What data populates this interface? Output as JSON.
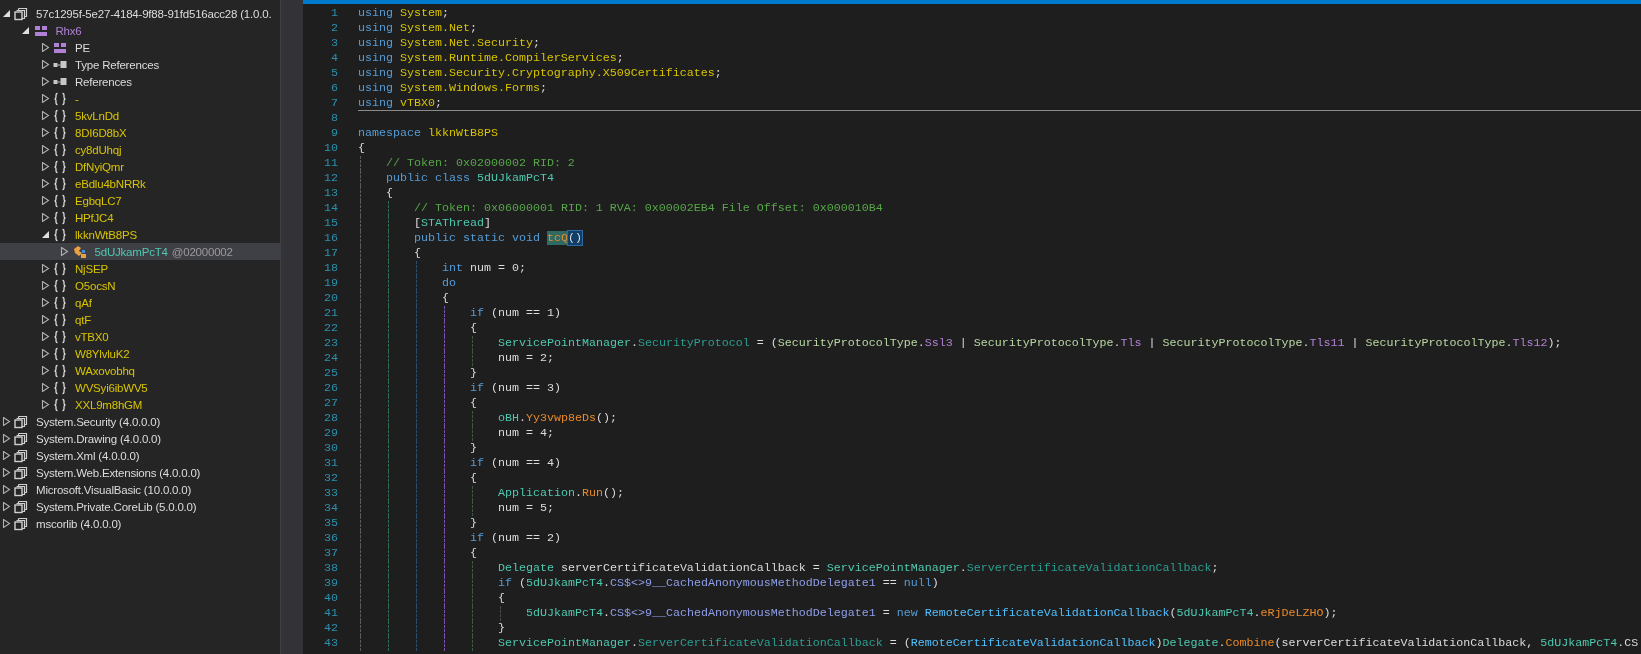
{
  "tree": [
    {
      "label": "57c1295f-5e27-4184-9f88-91fd516acc28 (1.0.0.",
      "kind": "assembly",
      "expanded": true,
      "selected": false,
      "children": [
        {
          "label": "Rhx6",
          "kind": "module",
          "expanded": true,
          "selected": false,
          "children": [
            {
              "label": "PE",
              "kind": "pe",
              "expanded": false,
              "selected": false
            },
            {
              "label": "Type References",
              "kind": "refs",
              "expanded": false,
              "selected": false
            },
            {
              "label": "References",
              "kind": "refs",
              "expanded": false,
              "selected": false
            },
            {
              "label": "-",
              "kind": "namespace",
              "expanded": false,
              "selected": false
            },
            {
              "label": "5kvLnDd",
              "kind": "namespace",
              "expanded": false,
              "selected": false
            },
            {
              "label": "8DI6D8bX",
              "kind": "namespace",
              "expanded": false,
              "selected": false
            },
            {
              "label": "cy8dUhqj",
              "kind": "namespace",
              "expanded": false,
              "selected": false
            },
            {
              "label": "DfNyiQmr",
              "kind": "namespace",
              "expanded": false,
              "selected": false
            },
            {
              "label": "eBdlu4bNRRk",
              "kind": "namespace",
              "expanded": false,
              "selected": false
            },
            {
              "label": "EgbqLC7",
              "kind": "namespace",
              "expanded": false,
              "selected": false
            },
            {
              "label": "HPfJC4",
              "kind": "namespace",
              "expanded": false,
              "selected": false
            },
            {
              "label": "lkknWtB8PS",
              "kind": "namespace",
              "expanded": true,
              "selected": false,
              "children": [
                {
                  "label": "5dUJkamPcT4",
                  "token": "@02000002",
                  "kind": "class",
                  "expanded": false,
                  "selected": true
                }
              ]
            },
            {
              "label": "NjSEP",
              "kind": "namespace",
              "expanded": false,
              "selected": false
            },
            {
              "label": "O5ocsN",
              "kind": "namespace",
              "expanded": false,
              "selected": false
            },
            {
              "label": "qAf",
              "kind": "namespace",
              "expanded": false,
              "selected": false
            },
            {
              "label": "qtF",
              "kind": "namespace",
              "expanded": false,
              "selected": false
            },
            {
              "label": "vTBX0",
              "kind": "namespace",
              "expanded": false,
              "selected": false
            },
            {
              "label": "W8YlvluK2",
              "kind": "namespace",
              "expanded": false,
              "selected": false
            },
            {
              "label": "WAxovobhq",
              "kind": "namespace",
              "expanded": false,
              "selected": false
            },
            {
              "label": "WVSyi6ibWV5",
              "kind": "namespace",
              "expanded": false,
              "selected": false
            },
            {
              "label": "XXL9m8hGM",
              "kind": "namespace",
              "expanded": false,
              "selected": false
            }
          ]
        }
      ]
    },
    {
      "label": "System.Security (4.0.0.0)",
      "kind": "assembly",
      "expanded": false,
      "selected": false
    },
    {
      "label": "System.Drawing (4.0.0.0)",
      "kind": "assembly",
      "expanded": false,
      "selected": false
    },
    {
      "label": "System.Xml (4.0.0.0)",
      "kind": "assembly",
      "expanded": false,
      "selected": false
    },
    {
      "label": "System.Web.Extensions (4.0.0.0)",
      "kind": "assembly",
      "expanded": false,
      "selected": false
    },
    {
      "label": "Microsoft.VisualBasic (10.0.0.0)",
      "kind": "assembly",
      "expanded": false,
      "selected": false
    },
    {
      "label": "System.Private.CoreLib (5.0.0.0)",
      "kind": "assembly",
      "expanded": false,
      "selected": false
    },
    {
      "label": "mscorlib (4.0.0.0)",
      "kind": "assembly",
      "expanded": false,
      "selected": false
    }
  ],
  "editor": {
    "lines": [
      {
        "number": "1",
        "tokens": [
          {
            "text": "using",
            "kind": "keyword"
          },
          {
            "text": " System",
            "kind": "namespace"
          },
          {
            "text": ";",
            "kind": "plain"
          }
        ]
      },
      {
        "number": "2",
        "tokens": [
          {
            "text": "using",
            "kind": "keyword"
          },
          {
            "text": " System.Net",
            "kind": "namespace"
          },
          {
            "text": ";",
            "kind": "plain"
          }
        ]
      },
      {
        "number": "3",
        "tokens": [
          {
            "text": "using",
            "kind": "keyword"
          },
          {
            "text": " System.Net.Security",
            "kind": "namespace"
          },
          {
            "text": ";",
            "kind": "plain"
          }
        ]
      },
      {
        "number": "4",
        "tokens": [
          {
            "text": "using",
            "kind": "keyword"
          },
          {
            "text": " System.Runtime.CompilerServices",
            "kind": "namespace"
          },
          {
            "text": ";",
            "kind": "plain"
          }
        ]
      },
      {
        "number": "5",
        "tokens": [
          {
            "text": "using",
            "kind": "keyword"
          },
          {
            "text": " System.Security.Cryptography.X509Certificates",
            "kind": "namespace"
          },
          {
            "text": ";",
            "kind": "plain"
          }
        ]
      },
      {
        "number": "6",
        "tokens": [
          {
            "text": "using",
            "kind": "keyword"
          },
          {
            "text": " System.Windows.Forms",
            "kind": "namespace"
          },
          {
            "text": ";",
            "kind": "plain"
          }
        ]
      },
      {
        "number": "7",
        "separator": true,
        "tokens": [
          {
            "text": "using",
            "kind": "keyword"
          },
          {
            "text": " vTBX0",
            "kind": "namespace"
          },
          {
            "text": ";",
            "kind": "plain"
          }
        ]
      },
      {
        "number": "8"
      },
      {
        "number": "9",
        "tokens": [
          {
            "text": "namespace",
            "kind": "keyword"
          },
          {
            "text": " lkknWtB8PS",
            "kind": "namespace"
          }
        ]
      },
      {
        "number": "10",
        "tokens": [
          {
            "text": "{",
            "kind": "open"
          }
        ]
      },
      {
        "number": "11",
        "tokens": [
          {
            "text": "// Token: 0x02000002 RID: 2",
            "kind": "comment"
          }
        ]
      },
      {
        "number": "12",
        "tokens": [
          {
            "text": "public class",
            "kind": "keyword"
          },
          {
            "text": " 5dUJkamPcT4",
            "kind": "type"
          }
        ]
      },
      {
        "number": "13",
        "tokens": [
          {
            "text": "{",
            "kind": "open"
          }
        ]
      },
      {
        "number": "14",
        "tokens": [
          {
            "text": "// Token: 0x06000001 RID: 1 RVA: 0x00002EB4 File Offset: 0x000010B4",
            "kind": "comment"
          }
        ]
      },
      {
        "number": "15",
        "tokens": [
          {
            "text": "[",
            "kind": "plain"
          },
          {
            "text": "STAThread",
            "kind": "type"
          },
          {
            "text": "]",
            "kind": "plain"
          }
        ]
      },
      {
        "number": "16",
        "tokens": [
          {
            "text": "public static void ",
            "kind": "keyword"
          },
          {
            "text": "tcQ",
            "kind": "selection"
          },
          {
            "text": "()",
            "kind": "brace_match"
          }
        ]
      },
      {
        "number": "17",
        "tokens": [
          {
            "text": "{",
            "kind": "open"
          }
        ]
      },
      {
        "number": "18",
        "tokens": [
          {
            "text": "int",
            "kind": "keyword"
          },
          {
            "text": " num = 0;",
            "kind": "plain"
          }
        ]
      },
      {
        "number": "19",
        "tokens": [
          {
            "text": "do",
            "kind": "keyword"
          }
        ]
      },
      {
        "number": "20",
        "tokens": [
          {
            "text": "{",
            "kind": "open"
          }
        ]
      },
      {
        "number": "21",
        "tokens": [
          {
            "text": "if",
            "kind": "keyword"
          },
          {
            "text": " (num == 1)",
            "kind": "plain"
          }
        ]
      },
      {
        "number": "22",
        "tokens": [
          {
            "text": "{",
            "kind": "open"
          }
        ]
      },
      {
        "number": "23",
        "tokens": [
          {
            "text": "ServicePointManager",
            "kind": "type"
          },
          {
            "text": ".",
            "kind": "plain"
          },
          {
            "text": "SecurityProtocol",
            "kind": "property"
          },
          {
            "text": " = (",
            "kind": "plain"
          },
          {
            "text": "SecurityProtocolType",
            "kind": "enum_type"
          },
          {
            "text": ".",
            "kind": "plain"
          },
          {
            "text": "Ssl3",
            "kind": "enum_value"
          },
          {
            "text": " | ",
            "kind": "plain"
          },
          {
            "text": "SecurityProtocolType",
            "kind": "enum_type"
          },
          {
            "text": ".",
            "kind": "plain"
          },
          {
            "text": "Tls",
            "kind": "enum_value"
          },
          {
            "text": " | ",
            "kind": "plain"
          },
          {
            "text": "SecurityProtocolType",
            "kind": "enum_type"
          },
          {
            "text": ".",
            "kind": "plain"
          },
          {
            "text": "Tls11",
            "kind": "enum_value"
          },
          {
            "text": " | ",
            "kind": "plain"
          },
          {
            "text": "SecurityProtocolType",
            "kind": "enum_type"
          },
          {
            "text": ".",
            "kind": "plain"
          },
          {
            "text": "Tls12",
            "kind": "enum_value"
          },
          {
            "text": ");",
            "kind": "plain"
          }
        ]
      },
      {
        "number": "24",
        "tokens": [
          {
            "text": "num = 2;",
            "kind": "plain"
          }
        ]
      },
      {
        "number": "25",
        "tokens": [
          {
            "text": "}",
            "kind": "close"
          }
        ]
      },
      {
        "number": "26",
        "tokens": [
          {
            "text": "if",
            "kind": "keyword"
          },
          {
            "text": " (num == 3)",
            "kind": "plain"
          }
        ]
      },
      {
        "number": "27",
        "tokens": [
          {
            "text": "{",
            "kind": "open"
          }
        ]
      },
      {
        "number": "28",
        "tokens": [
          {
            "text": "oBH",
            "kind": "type"
          },
          {
            "text": ".",
            "kind": "plain"
          },
          {
            "text": "Yy3vwp8eDs",
            "kind": "method"
          },
          {
            "text": "();",
            "kind": "plain"
          }
        ]
      },
      {
        "number": "29",
        "tokens": [
          {
            "text": "num = 4;",
            "kind": "plain"
          }
        ]
      },
      {
        "number": "30",
        "tokens": [
          {
            "text": "}",
            "kind": "close"
          }
        ]
      },
      {
        "number": "31",
        "tokens": [
          {
            "text": "if",
            "kind": "keyword"
          },
          {
            "text": " (num == 4)",
            "kind": "plain"
          }
        ]
      },
      {
        "number": "32",
        "tokens": [
          {
            "text": "{",
            "kind": "open"
          }
        ]
      },
      {
        "number": "33",
        "tokens": [
          {
            "text": "Application",
            "kind": "type"
          },
          {
            "text": ".",
            "kind": "plain"
          },
          {
            "text": "Run",
            "kind": "method"
          },
          {
            "text": "();",
            "kind": "plain"
          }
        ]
      },
      {
        "number": "34",
        "tokens": [
          {
            "text": "num = 5;",
            "kind": "plain"
          }
        ]
      },
      {
        "number": "35",
        "tokens": [
          {
            "text": "}",
            "kind": "close"
          }
        ]
      },
      {
        "number": "36",
        "tokens": [
          {
            "text": "if",
            "kind": "keyword"
          },
          {
            "text": " (num == 2)",
            "kind": "plain"
          }
        ]
      },
      {
        "number": "37",
        "tokens": [
          {
            "text": "{",
            "kind": "open"
          }
        ]
      },
      {
        "number": "38",
        "tokens": [
          {
            "text": "Delegate",
            "kind": "type"
          },
          {
            "text": " serverCertificateValidationCallback = ",
            "kind": "plain"
          },
          {
            "text": "ServicePointManager",
            "kind": "type"
          },
          {
            "text": ".",
            "kind": "plain"
          },
          {
            "text": "ServerCertificateValidationCallback",
            "kind": "property"
          },
          {
            "text": ";",
            "kind": "plain"
          }
        ]
      },
      {
        "number": "39",
        "tokens": [
          {
            "text": "if",
            "kind": "keyword"
          },
          {
            "text": " (",
            "kind": "plain"
          },
          {
            "text": "5dUJkamPcT4",
            "kind": "type"
          },
          {
            "text": ".",
            "kind": "plain"
          },
          {
            "text": "CS$<>9__CachedAnonymousMethodDelegate1",
            "kind": "field"
          },
          {
            "text": " == ",
            "kind": "plain"
          },
          {
            "text": "null",
            "kind": "keyword"
          },
          {
            "text": ")",
            "kind": "plain"
          }
        ]
      },
      {
        "number": "40",
        "tokens": [
          {
            "text": "{",
            "kind": "open"
          }
        ]
      },
      {
        "number": "41",
        "tokens": [
          {
            "text": "5dUJkamPcT4",
            "kind": "type"
          },
          {
            "text": ".",
            "kind": "plain"
          },
          {
            "text": "CS$<>9__CachedAnonymousMethodDelegate1",
            "kind": "field"
          },
          {
            "text": " = ",
            "kind": "plain"
          },
          {
            "text": "new",
            "kind": "keyword"
          },
          {
            "text": " RemoteCertificateValidationCallback",
            "kind": "delegate"
          },
          {
            "text": "(",
            "kind": "plain"
          },
          {
            "text": "5dUJkamPcT4",
            "kind": "type"
          },
          {
            "text": ".",
            "kind": "plain"
          },
          {
            "text": "eRjDeLZHO",
            "kind": "method"
          },
          {
            "text": ");",
            "kind": "plain"
          }
        ]
      },
      {
        "number": "42",
        "tokens": [
          {
            "text": "}",
            "kind": "close"
          }
        ]
      },
      {
        "number": "43",
        "tokens": [
          {
            "text": "ServicePointManager",
            "kind": "type"
          },
          {
            "text": ".",
            "kind": "plain"
          },
          {
            "text": "ServerCertificateValidationCallback",
            "kind": "property"
          },
          {
            "text": " = (",
            "kind": "plain"
          },
          {
            "text": "RemoteCertificateValidationCallback",
            "kind": "delegate"
          },
          {
            "text": ")",
            "kind": "plain"
          },
          {
            "text": "Delegate",
            "kind": "type"
          },
          {
            "text": ".",
            "kind": "plain"
          },
          {
            "text": "Combine",
            "kind": "method"
          },
          {
            "text": "(serverCertificateValidationCallback, ",
            "kind": "plain"
          },
          {
            "text": "5dUJkamPcT4",
            "kind": "type"
          },
          {
            "text": ".CS",
            "kind": "plain"
          }
        ]
      }
    ]
  }
}
